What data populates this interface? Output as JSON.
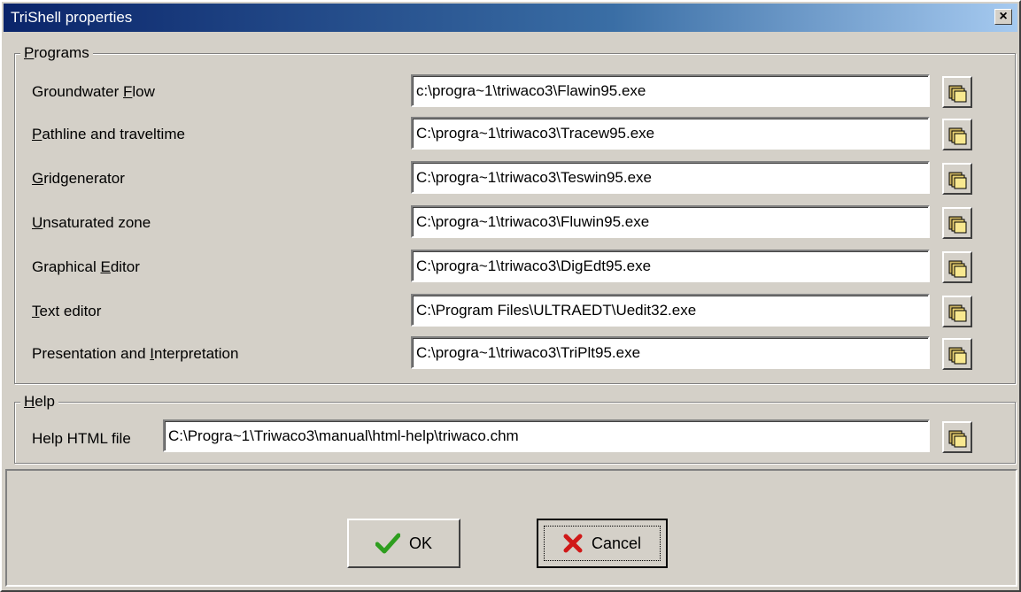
{
  "window": {
    "title": "TriShell properties",
    "close_label": "×"
  },
  "programs": {
    "legend": "Programs",
    "rows": [
      {
        "label_pre": "Groundwater ",
        "label_ul": "F",
        "label_post": "low",
        "value": "c:\\progra~1\\triwaco3\\Flawin95.exe"
      },
      {
        "label_pre": "",
        "label_ul": "P",
        "label_post": "athline and traveltime",
        "value": "C:\\progra~1\\triwaco3\\Tracew95.exe"
      },
      {
        "label_pre": "",
        "label_ul": "G",
        "label_post": "ridgenerator",
        "value": "C:\\progra~1\\triwaco3\\Teswin95.exe"
      },
      {
        "label_pre": "",
        "label_ul": "U",
        "label_post": "nsaturated zone",
        "value": "C:\\progra~1\\triwaco3\\Fluwin95.exe"
      },
      {
        "label_pre": "Graphical ",
        "label_ul": "E",
        "label_post": "ditor",
        "value": "C:\\progra~1\\triwaco3\\DigEdt95.exe"
      },
      {
        "label_pre": "",
        "label_ul": "T",
        "label_post": "ext editor",
        "value": "C:\\Program Files\\ULTRAEDT\\Uedit32.exe"
      },
      {
        "label_pre": "Presentation and ",
        "label_ul": "I",
        "label_post": "nterpretation",
        "value": "C:\\progra~1\\triwaco3\\TriPlt95.exe"
      }
    ]
  },
  "help": {
    "legend": "Help",
    "label": "Help HTML file",
    "value": "C:\\Progra~1\\Triwaco3\\manual\\html-help\\triwaco.chm"
  },
  "buttons": {
    "ok_label": "OK",
    "cancel_label": "Cancel"
  },
  "icons": {
    "browse": "folder-open-icon",
    "ok": "checkmark-icon",
    "cancel": "x-mark-icon"
  },
  "colors": {
    "titlebar_start": "#0a246a",
    "titlebar_end": "#a6caf0",
    "ok_green": "#2e9e1f",
    "cancel_red": "#d01818"
  }
}
